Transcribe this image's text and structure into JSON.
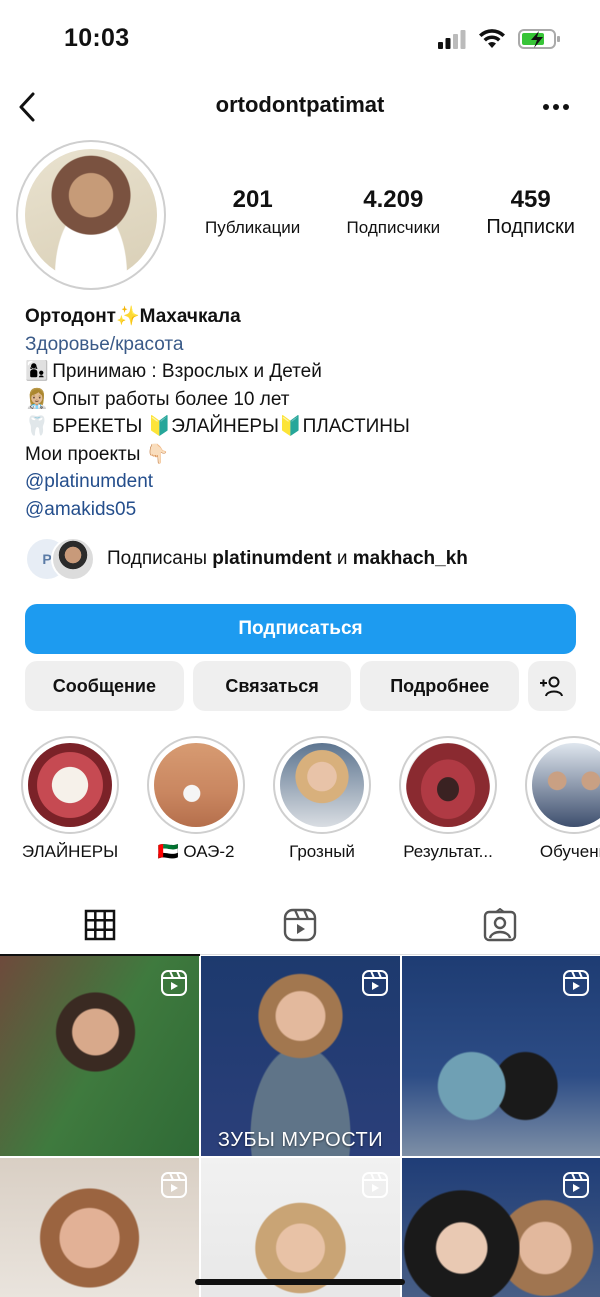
{
  "status": {
    "time": "10:03"
  },
  "nav": {
    "username": "ortodontpatimat"
  },
  "stats": [
    {
      "value": "201",
      "label": "Публикации"
    },
    {
      "value": "4.209",
      "label": "Подписчики"
    },
    {
      "value": "459",
      "label": "Подписки"
    }
  ],
  "bio": {
    "name": "Ортодонт✨Махачкала",
    "category": "Здоровье/красота",
    "lines": [
      {
        "emoji": "👩‍👦",
        "text": " Принимаю : Взрослых  и Детей"
      },
      {
        "emoji": "👩🏼‍⚕️",
        "text": "Опыт работы более 10 лет"
      },
      {
        "emoji": "🦷",
        "text": "БРЕКЕТЫ 🔰ЭЛАЙНЕРЫ🔰ПЛАСТИНЫ"
      },
      {
        "emoji": "",
        "text": "Мои проекты 👇🏻"
      }
    ],
    "links": [
      "@platinumdent",
      "@amakids05"
    ]
  },
  "followed_by": {
    "prefix": "Подписаны ",
    "user1": "platinumdent",
    "joiner": " и ",
    "user2": "makhach_kh"
  },
  "buttons": {
    "follow": "Подписаться",
    "message": "Сообщение",
    "contact": "Связаться",
    "more": "Подробнее"
  },
  "highlights": [
    "ЭЛАЙНЕРЫ",
    "🇦🇪 ОАЭ-2",
    "Грозный",
    "Результат...",
    "Обучени"
  ],
  "grid_overlay_text": "ЗУБЫ МУРОСТИ",
  "colors": {
    "follow_button": "#1d9bf0",
    "secondary_button": "#efefef",
    "link": "#244e8c"
  }
}
